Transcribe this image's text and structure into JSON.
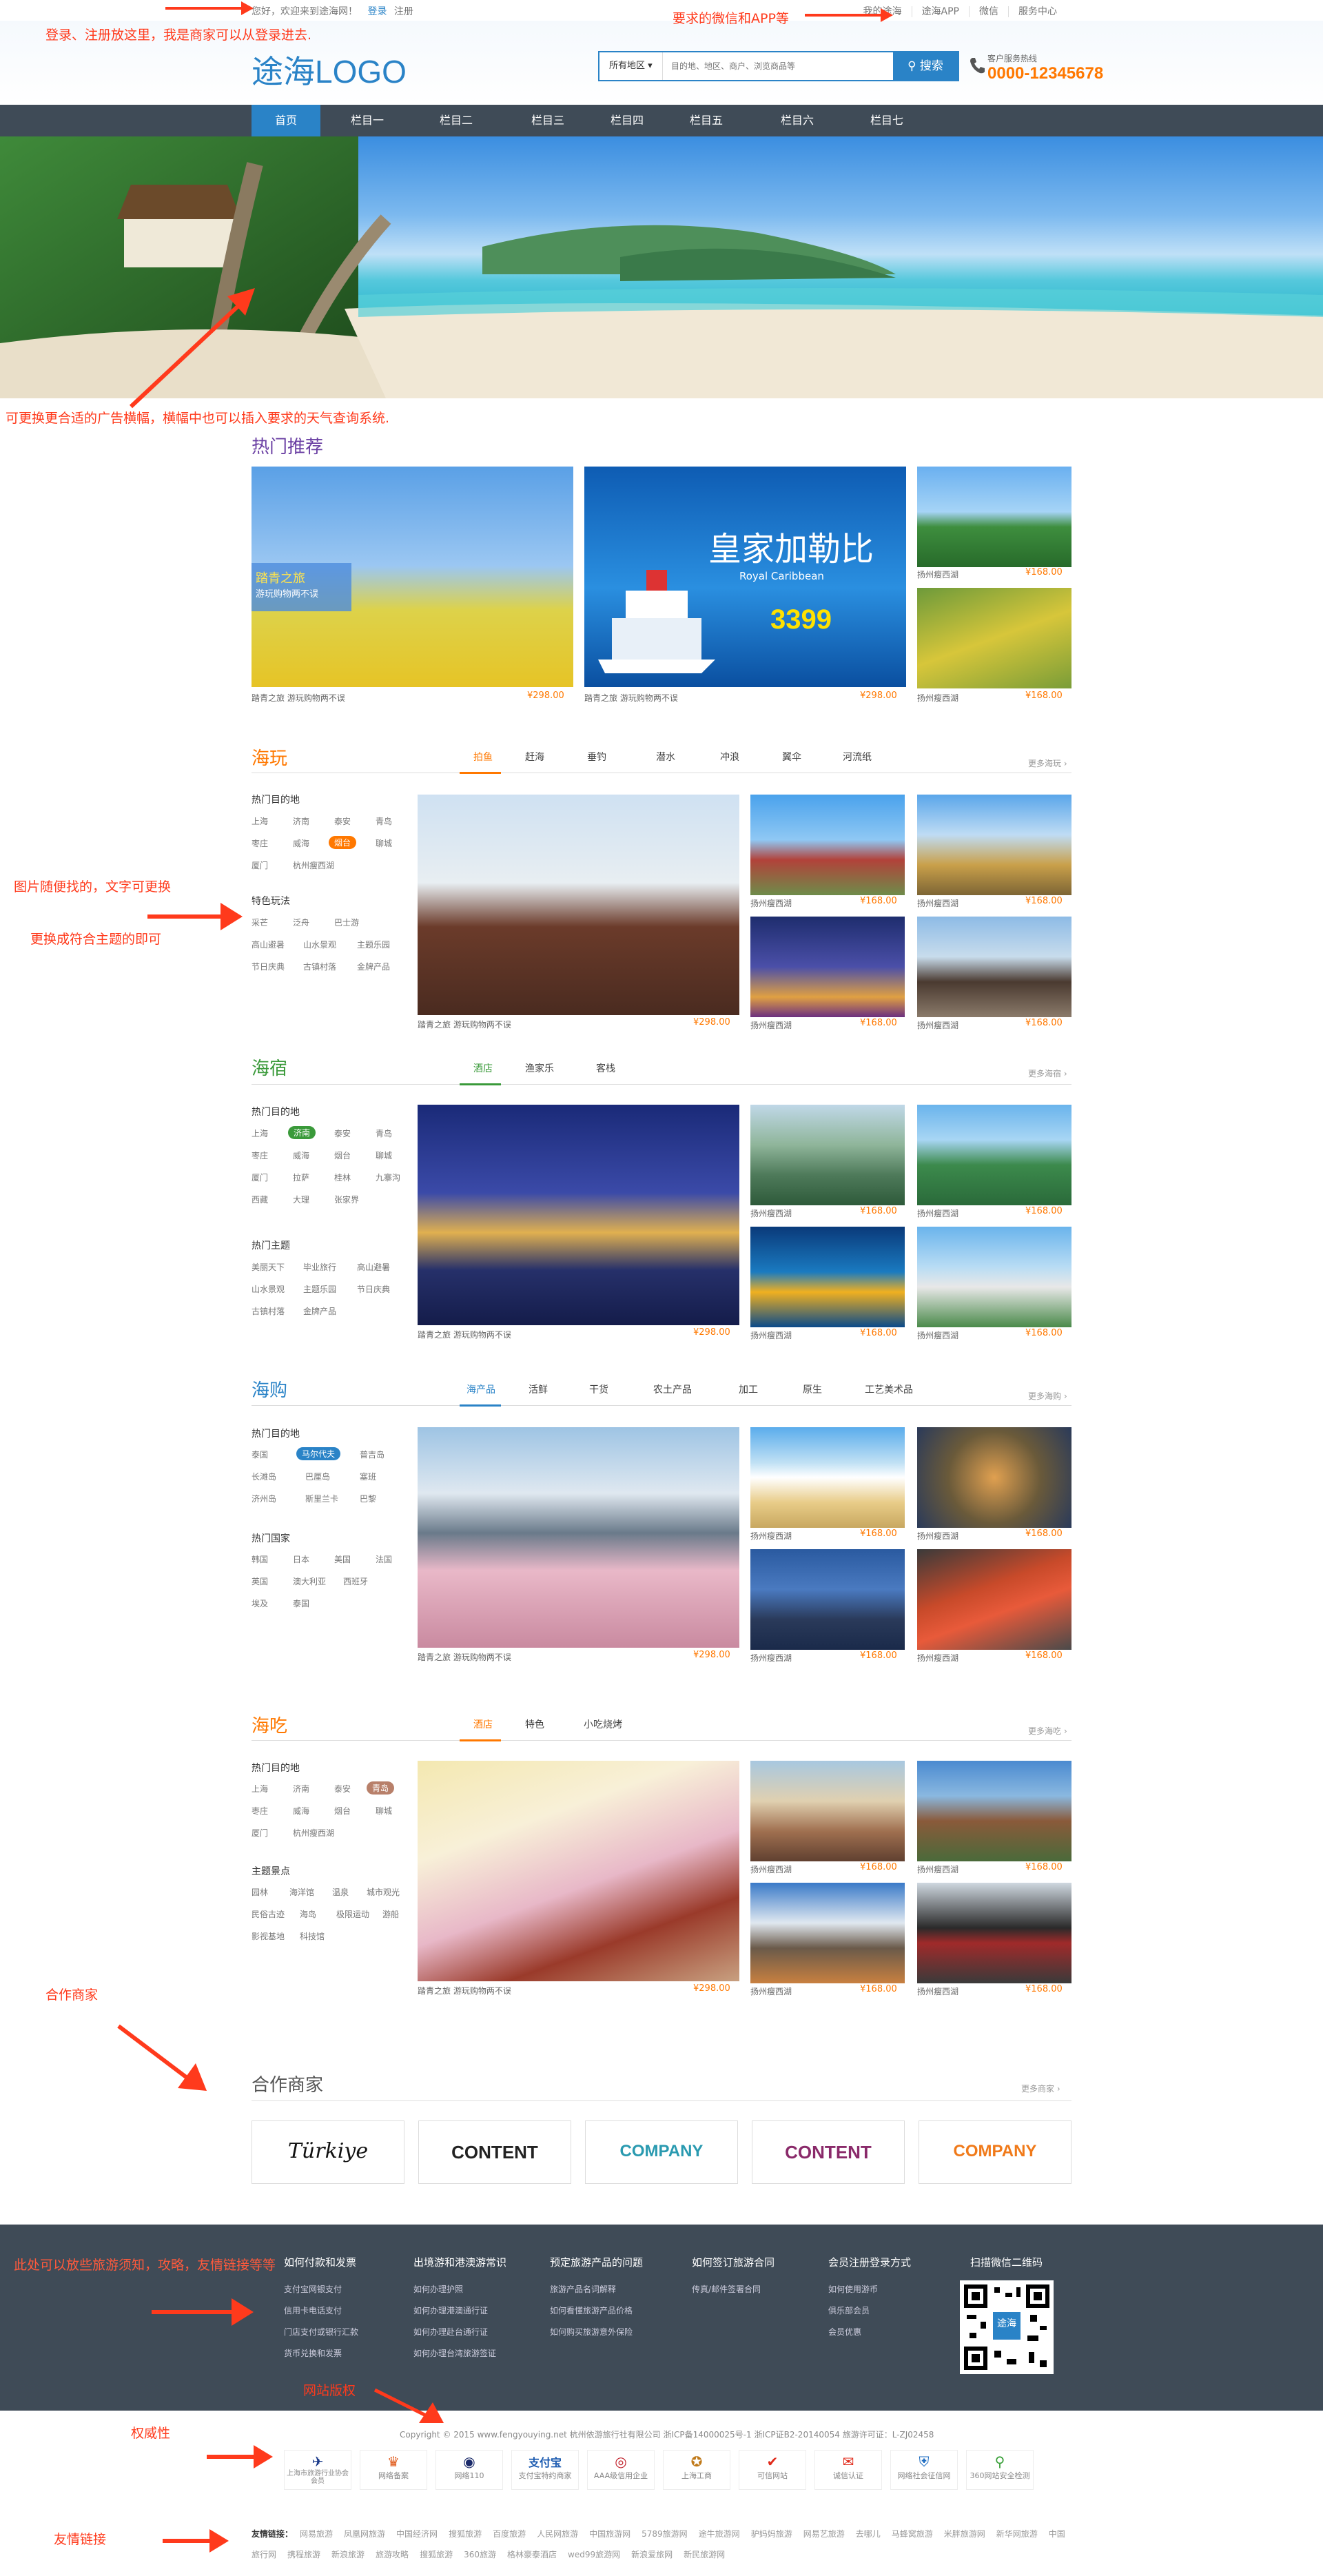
{
  "annotations": {
    "login": "登录、注册放这里，我是商家可以从登录进去.",
    "wechat": "要求的微信和APP等",
    "banner": "可更换更合适的广告横幅，横幅中也可以插入要求的天气查询系统.",
    "img1": "图片随便找的，文字可更换",
    "img2": "更换成符合主题的即可",
    "partner": "合作商家",
    "footer": "此处可以放些旅游须知，攻略，友情链接等等",
    "copyright": "网站版权",
    "authority": "权威性",
    "links": "友情链接"
  },
  "topbar": {
    "welcome": "您好，欢迎来到途海网！",
    "login": "登录",
    "register": "注册",
    "right": [
      "我的途海",
      "途海APP",
      "微信",
      "服务中心"
    ]
  },
  "header": {
    "logo": "途海LOGO",
    "search_select": "所有地区",
    "search_placeholder": "目的地、地区、商户、浏览商品等",
    "search_button": "搜索",
    "hotline_label": "客户服务热线",
    "hotline": "0000-12345678"
  },
  "nav": [
    "首页",
    "栏目一",
    "栏目二",
    "栏目三",
    "栏目四",
    "栏目五",
    "栏目六",
    "栏目七"
  ],
  "hot": {
    "title": "热门推荐",
    "overlay1": "踏青之旅",
    "overlay2": "游玩购物两不误",
    "ad_big": "皇家加勒比",
    "ad_sub": "Royal Caribbean",
    "ad_price": "3399",
    "items": [
      {
        "cap": "踏青之旅  游玩购物两不误",
        "price": "¥298.00"
      },
      {
        "cap": "踏青之旅  游玩购物两不误",
        "price": "¥298.00"
      },
      {
        "cap": "扬州瘦西湖",
        "price": "¥168.00"
      },
      {
        "cap": "扬州瘦西湖",
        "price": "¥168.00"
      }
    ]
  },
  "sec1": {
    "title": "海玩",
    "tabs": [
      "拍鱼",
      "赶海",
      "垂钓",
      "潜水",
      "冲浪",
      "翼伞",
      "河流纸"
    ],
    "more": "更多海玩",
    "h1": "热门目的地",
    "tags1": [
      "上海",
      "济南",
      "泰安",
      "青岛",
      "枣庄",
      "威海",
      "烟台",
      "聊城",
      "厦门",
      "杭州瘦西湖"
    ],
    "h2": "特色玩法",
    "tags2": [
      "采芒",
      "泛舟",
      "巴士游",
      "高山避暑",
      "山水景观",
      "主题乐园",
      "节日庆典",
      "古镇村落",
      "金牌产品"
    ],
    "main_cap": "踏青之旅  游玩购物两不误",
    "main_price": "¥298.00",
    "items": [
      {
        "cap": "扬州瘦西湖",
        "price": "¥168.00"
      },
      {
        "cap": "扬州瘦西湖",
        "price": "¥168.00"
      },
      {
        "cap": "扬州瘦西湖",
        "price": "¥168.00"
      },
      {
        "cap": "扬州瘦西湖",
        "price": "¥168.00"
      }
    ]
  },
  "sec2": {
    "title": "海宿",
    "tabs": [
      "酒店",
      "渔家乐",
      "客栈"
    ],
    "more": "更多海宿",
    "h1": "热门目的地",
    "tags1": [
      "上海",
      "济南",
      "泰安",
      "青岛",
      "枣庄",
      "威海",
      "烟台",
      "聊城",
      "厦门",
      "拉萨",
      "桂林",
      "九寨沟",
      "西藏",
      "大理",
      "张家界"
    ],
    "h2": "热门主题",
    "tags2": [
      "美丽天下",
      "毕业旅行",
      "高山避暑",
      "山水景观",
      "主题乐园",
      "节日庆典",
      "古镇村落",
      "金牌产品"
    ],
    "main_cap": "踏青之旅  游玩购物两不误",
    "main_price": "¥298.00",
    "items": [
      {
        "cap": "扬州瘦西湖",
        "price": "¥168.00"
      },
      {
        "cap": "扬州瘦西湖",
        "price": "¥168.00"
      },
      {
        "cap": "扬州瘦西湖",
        "price": "¥168.00"
      },
      {
        "cap": "扬州瘦西湖",
        "price": "¥168.00"
      }
    ]
  },
  "sec3": {
    "title": "海购",
    "tabs": [
      "海产品",
      "活鲜",
      "干货",
      "农土产品",
      "加工",
      "原生",
      "工艺美术品"
    ],
    "more": "更多海购",
    "h1": "热门目的地",
    "tags1": [
      "泰国",
      "马尔代夫",
      "普吉岛",
      "长滩岛",
      "巴厘岛",
      "塞班",
      "济州岛",
      "斯里兰卡",
      "巴黎"
    ],
    "h2": "热门国家",
    "tags2": [
      "韩国",
      "日本",
      "美国",
      "法国",
      "英国",
      "澳大利亚",
      "西班牙",
      "埃及",
      "泰国"
    ],
    "main_cap": "踏青之旅  游玩购物两不误",
    "main_price": "¥298.00",
    "items": [
      {
        "cap": "扬州瘦西湖",
        "price": "¥168.00"
      },
      {
        "cap": "扬州瘦西湖",
        "price": "¥168.00"
      },
      {
        "cap": "扬州瘦西湖",
        "price": "¥168.00"
      },
      {
        "cap": "扬州瘦西湖",
        "price": "¥168.00"
      }
    ]
  },
  "sec4": {
    "title": "海吃",
    "tabs": [
      "酒店",
      "特色",
      "小吃烧烤"
    ],
    "more": "更多海吃",
    "h1": "热门目的地",
    "tags1": [
      "上海",
      "济南",
      "泰安",
      "青岛",
      "枣庄",
      "威海",
      "烟台",
      "聊城",
      "厦门",
      "杭州瘦西湖"
    ],
    "h2": "主题景点",
    "tags2": [
      "园林",
      "海洋馆",
      "温泉",
      "城市观光",
      "民俗古迹",
      "海岛",
      "极限运动",
      "游船",
      "影视基地",
      "科技馆"
    ],
    "main_cap": "踏青之旅  游玩购物两不误",
    "main_price": "¥298.00",
    "items": [
      {
        "cap": "扬州瘦西湖",
        "price": "¥168.00"
      },
      {
        "cap": "扬州瘦西湖",
        "price": "¥168.00"
      },
      {
        "cap": "扬州瘦西湖",
        "price": "¥168.00"
      },
      {
        "cap": "扬州瘦西湖",
        "price": "¥168.00"
      }
    ]
  },
  "partners": {
    "title": "合作商家",
    "more": "更多商家",
    "logos": [
      "Türkiye",
      "CONTENT",
      "COMPANY",
      "CONTENT",
      "COMPANY"
    ]
  },
  "footer": {
    "cols": [
      {
        "title": "如何付款和发票",
        "items": [
          "支付宝网银支付",
          "信用卡电话支付",
          "门店支付或银行汇款",
          "货币兑换和发票"
        ]
      },
      {
        "title": "出境游和港澳游常识",
        "items": [
          "如何办理护照",
          "如何办理港澳通行证",
          "如何办理赴台通行证",
          "如何办理台湾旅游签证"
        ]
      },
      {
        "title": "预定旅游产品的问题",
        "items": [
          "旅游产品名词解释",
          "如何看懂旅游产品价格",
          "如何购买旅游意外保险"
        ]
      },
      {
        "title": "如何签订旅游合同",
        "items": [
          "传真/邮件签署合同"
        ]
      },
      {
        "title": "会员注册登录方式",
        "items": [
          "如何使用游币",
          "俱乐部会员",
          "会员优惠"
        ]
      },
      {
        "title": "扫描微信二维码",
        "items": []
      }
    ],
    "qr": "途海"
  },
  "copyright": "Copyright © 2015  www.fengyouying.net   杭州依游旅行社有限公司    浙ICP备14000025号-1    浙ICP证B2-20140054    旅游许可证：L-ZJ02458",
  "trust": [
    "上海市旅游行业协会会员",
    "网络备案",
    "网络110",
    "支付宝特约商家",
    "AAA级信用企业",
    "上海工商",
    "可信网站",
    "诚信认证",
    "网络社会征信网",
    "360网站安全检测"
  ],
  "links": {
    "label": "友情链接：",
    "items": [
      "网易旅游",
      "凤凰网旅游",
      "中国经济网",
      "搜狐旅游",
      "百度旅游",
      "人民网旅游",
      "中国旅游网",
      "5789旅游网",
      "途牛旅游网",
      "驴妈妈旅游",
      "网易艺旅游",
      "去哪儿",
      "马蜂窝旅游",
      "米胖旅游网",
      "新华网旅游",
      "中国旅行网",
      "携程旅游",
      "新浪旅游",
      "旅游攻略",
      "搜狐旅游",
      "360旅游",
      "格林豪泰酒店",
      "wed99旅游网",
      "新浪爱旅网",
      "新民旅游网"
    ]
  },
  "colors": {
    "brand": "#2a83c7",
    "accent": "#ff7800",
    "nav": "#3f4b57",
    "annotation": "#ff3a1c"
  }
}
